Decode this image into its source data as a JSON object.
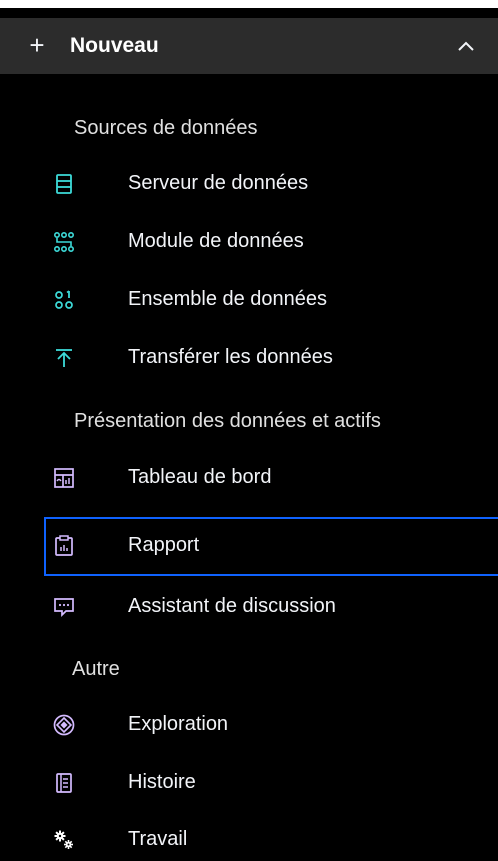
{
  "header": {
    "plus_glyph": "+",
    "title": "Nouveau"
  },
  "sections": {
    "sources": "Sources de données",
    "presentation": "Présentation des données et actifs",
    "other": "Autre"
  },
  "items": {
    "data_server": "Serveur de données",
    "data_module": "Module de données",
    "dataset": "Ensemble de données",
    "upload": "Transférer les données",
    "dashboard": "Tableau de bord",
    "report": "Rapport",
    "chat_assistant": "Assistant de discussion",
    "exploration": "Exploration",
    "story": "Histoire",
    "job": "Travail"
  },
  "colors": {
    "panel_bg": "#000000",
    "header_bg": "#2c2c2c",
    "teal_icon": "#3ddbd9",
    "purple_icon": "#d4bbff",
    "selected_border": "#0f62fe",
    "text": "#f2f4f8"
  }
}
